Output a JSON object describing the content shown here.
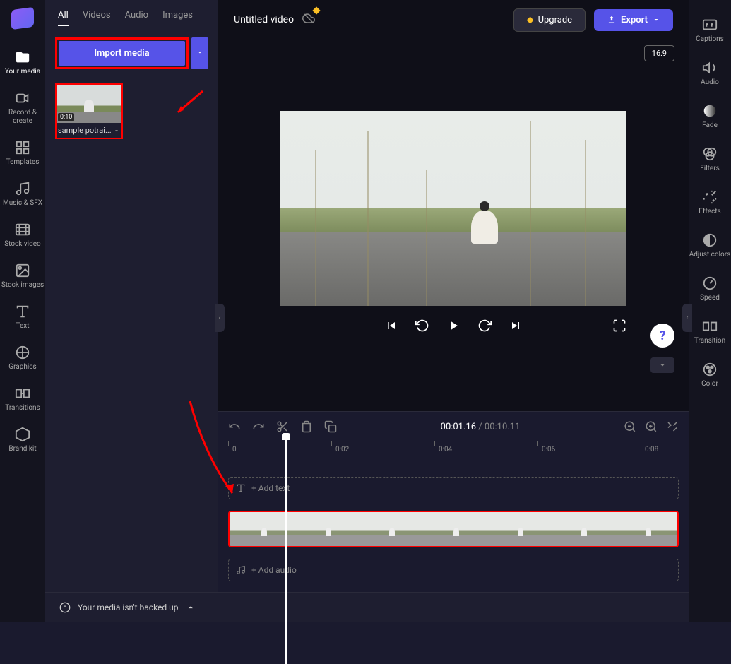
{
  "leftRail": {
    "items": [
      {
        "label": "Your media",
        "icon": "folder"
      },
      {
        "label": "Record & create",
        "icon": "camera"
      },
      {
        "label": "Templates",
        "icon": "templates"
      },
      {
        "label": "Music & SFX",
        "icon": "music"
      },
      {
        "label": "Stock video",
        "icon": "film"
      },
      {
        "label": "Stock images",
        "icon": "image"
      },
      {
        "label": "Text",
        "icon": "text"
      },
      {
        "label": "Graphics",
        "icon": "graphics"
      },
      {
        "label": "Transitions",
        "icon": "transitions"
      },
      {
        "label": "Brand kit",
        "icon": "brand"
      }
    ]
  },
  "mediaPanel": {
    "tabs": [
      "All",
      "Videos",
      "Audio",
      "Images"
    ],
    "importLabel": "Import media",
    "thumb": {
      "duration": "0:10",
      "name": "sample potrai..."
    }
  },
  "top": {
    "title": "Untitled video",
    "upgrade": "Upgrade",
    "export": "Export",
    "aspect": "16:9"
  },
  "timeline": {
    "current": "00:01.16",
    "total": "00:10.11",
    "ruler": [
      "0",
      "0:02",
      "0:04",
      "0:06",
      "0:08"
    ],
    "addText": "+ Add text",
    "addAudio": "+ Add audio"
  },
  "rightRail": {
    "items": [
      {
        "label": "Captions"
      },
      {
        "label": "Audio"
      },
      {
        "label": "Fade"
      },
      {
        "label": "Filters"
      },
      {
        "label": "Effects"
      },
      {
        "label": "Adjust colors"
      },
      {
        "label": "Speed"
      },
      {
        "label": "Transition"
      },
      {
        "label": "Color"
      }
    ]
  },
  "bottom": {
    "warning": "Your media isn't backed up"
  }
}
